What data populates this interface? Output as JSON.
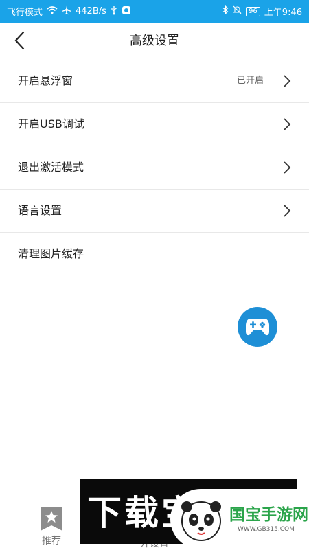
{
  "status_bar": {
    "left_text": "飞行模式",
    "speed": "442B/s",
    "battery": "96",
    "time": "上午9:46"
  },
  "header": {
    "title": "高级设置"
  },
  "settings": [
    {
      "label": "开启悬浮窗",
      "value": "已开启",
      "has_chevron": true
    },
    {
      "label": "开启USB调试",
      "value": "",
      "has_chevron": true
    },
    {
      "label": "退出激活模式",
      "value": "",
      "has_chevron": true
    },
    {
      "label": "语言设置",
      "value": "",
      "has_chevron": true
    },
    {
      "label": "清理图片缓存",
      "value": "",
      "has_chevron": false
    }
  ],
  "bottom_nav": [
    {
      "label": "推荐",
      "icon": "star-icon"
    },
    {
      "label": "开设置",
      "icon": ""
    }
  ],
  "watermark": {
    "banner_text": "下载宝游源",
    "site_name": "国宝手游网",
    "site_url": "WWW.GB315.COM"
  },
  "colors": {
    "status_bar": "#1aa3e8",
    "fab": "#1e8fd6",
    "watermark_green": "#2aa44a"
  }
}
